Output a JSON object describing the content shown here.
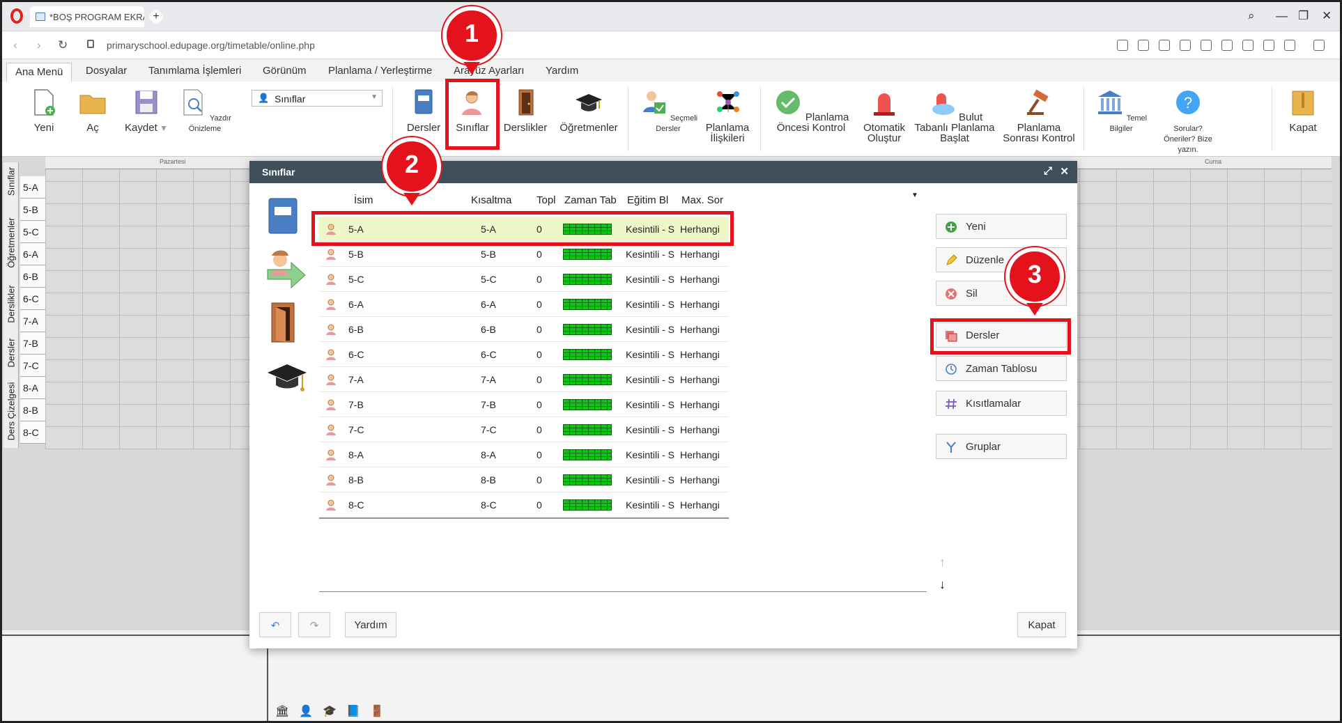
{
  "browser": {
    "tab_title": "*BOŞ PROGRAM EKRAN F",
    "url": "primaryschool.edupage.org/timetable/online.php"
  },
  "menu": {
    "tabs": [
      "Ana Menü",
      "Dosyalar",
      "Tanımlama İşlemleri",
      "Görünüm",
      "Planlama / Yerleştirme",
      "Arayüz Ayarları",
      "Yardım"
    ]
  },
  "ribbon": {
    "yeni": "Yeni",
    "ac": "Aç",
    "kaydet": "Kaydet",
    "yazdir": "Yazdır Önizleme",
    "combo_value": "Sınıflar",
    "dersler": "Dersler",
    "siniflar": "Sınıflar",
    "derslikler": "Derslikler",
    "ogretmenler": "Öğretmenler",
    "secmeli": "Seçmeli Dersler",
    "planlama_iliskileri": "Planlama İlişkileri",
    "planlama_oncesi": "Planlama Öncesi Kontrol",
    "otomatik": "Otomatik Oluştur",
    "bulut": "Bulut Tabanlı Planlama Başlat",
    "planlama_sonrasi": "Planlama Sonrası Kontrol",
    "temel": "Temel Bilgiler",
    "sorular": "Sorular? Öneriler? Bize yazın.",
    "kapat": "Kapat"
  },
  "timetable": {
    "day_first": "Pazartesi",
    "day_last": "Cuma",
    "side_tabs": [
      "Sınıflar",
      "Öğretmenler",
      "Derslikler",
      "Dersler",
      "Ders Çizelgesi"
    ],
    "rows": [
      "5-A",
      "5-B",
      "5-C",
      "6-A",
      "6-B",
      "6-C",
      "7-A",
      "7-B",
      "7-C",
      "8-A",
      "8-B",
      "8-C"
    ]
  },
  "dialog": {
    "title": "Sınıflar",
    "columns": [
      "İsim",
      "Kısaltma",
      "Topl",
      "Zaman Tab",
      "Eğitim Bl",
      "Max. Sor"
    ],
    "rows": [
      {
        "name": "5-A",
        "short": "5-A",
        "total": "0",
        "edu": "Kesintili - S",
        "max": "Herhangi"
      },
      {
        "name": "5-B",
        "short": "5-B",
        "total": "0",
        "edu": "Kesintili - S",
        "max": "Herhangi"
      },
      {
        "name": "5-C",
        "short": "5-C",
        "total": "0",
        "edu": "Kesintili - S",
        "max": "Herhangi"
      },
      {
        "name": "6-A",
        "short": "6-A",
        "total": "0",
        "edu": "Kesintili - S",
        "max": "Herhangi"
      },
      {
        "name": "6-B",
        "short": "6-B",
        "total": "0",
        "edu": "Kesintili - S",
        "max": "Herhangi"
      },
      {
        "name": "6-C",
        "short": "6-C",
        "total": "0",
        "edu": "Kesintili - S",
        "max": "Herhangi"
      },
      {
        "name": "7-A",
        "short": "7-A",
        "total": "0",
        "edu": "Kesintili - S",
        "max": "Herhangi"
      },
      {
        "name": "7-B",
        "short": "7-B",
        "total": "0",
        "edu": "Kesintili - S",
        "max": "Herhangi"
      },
      {
        "name": "7-C",
        "short": "7-C",
        "total": "0",
        "edu": "Kesintili - S",
        "max": "Herhangi"
      },
      {
        "name": "8-A",
        "short": "8-A",
        "total": "0",
        "edu": "Kesintili - S",
        "max": "Herhangi"
      },
      {
        "name": "8-B",
        "short": "8-B",
        "total": "0",
        "edu": "Kesintili - S",
        "max": "Herhangi"
      },
      {
        "name": "8-C",
        "short": "8-C",
        "total": "0",
        "edu": "Kesintili - S",
        "max": "Herhangi"
      }
    ],
    "actions": {
      "yeni": "Yeni",
      "duzenle": "Düzenle",
      "sil": "Sil",
      "dersler": "Dersler",
      "zaman": "Zaman Tablosu",
      "kisitlamalar": "Kısıtlamalar",
      "gruplar": "Gruplar"
    },
    "footer": {
      "yardim": "Yardım",
      "kapat": "Kapat"
    }
  },
  "annotations": {
    "step1": "1",
    "step2": "2",
    "step3": "3"
  },
  "colors": {
    "highlight_red": "#e3121b",
    "dialog_header": "#3e4f5a",
    "selected_row": "#eef7c8",
    "timetable_bar": "#12c41a"
  }
}
